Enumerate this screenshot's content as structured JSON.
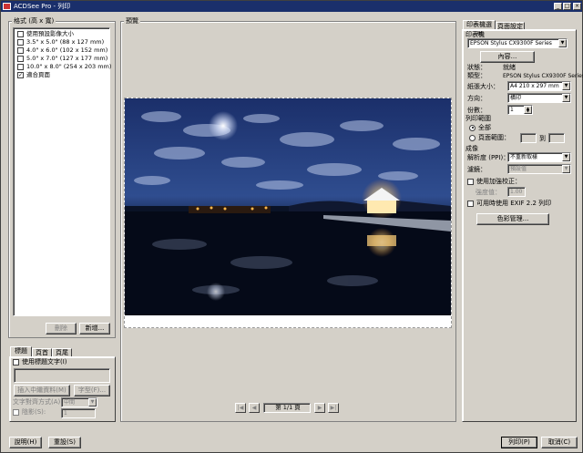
{
  "window": {
    "title": "ACDSee Pro - 列印"
  },
  "format_panel": {
    "group_label": "格式 (高 x 寬)",
    "items": [
      {
        "label": "使用預設影像大小",
        "checked": false
      },
      {
        "label": "3.5\" x 5.0\" (88 x 127 mm)",
        "checked": false
      },
      {
        "label": "4.0\" x 6.0\" (102 x 152 mm)",
        "checked": false
      },
      {
        "label": "5.0\" x 7.0\" (127 x 177 mm)",
        "checked": false
      },
      {
        "label": "10.0\" x 8.0\" (254 x 203 mm)",
        "checked": false
      },
      {
        "label": "適合頁面",
        "checked": true
      }
    ],
    "remove_button": "刪除",
    "new_button": "新增..."
  },
  "text_panel": {
    "tabs": [
      "標題",
      "頁首",
      "頁尾"
    ],
    "use_text_label": "使用標題文字(I)",
    "insert_metadata": "插入中繼資料(M)",
    "font_button": "字型(F)...",
    "alignment_label": "文字對齊方式(A):",
    "alignment_value": "中間",
    "shadow_label": "陰影(S):",
    "shadow_value": "1"
  },
  "preview": {
    "label": "預覽",
    "page_indicator": "第 1/1 頁"
  },
  "right_panel": {
    "tabs": [
      "印表機選項",
      "頁面設定"
    ],
    "printer_group": "印表機",
    "printer_name": "EPSON Stylus CX9300F Series",
    "properties_button": "內容...",
    "status_label": "狀態：",
    "status_value": "就緒",
    "type_label": "類型：",
    "type_value": "EPSON Stylus CX9300F Series",
    "paper_label": "紙張大小：",
    "paper_value": "A4 210 x 297 mm",
    "orientation_label": "方向：",
    "orientation_value": "橫印",
    "copies_label": "份數：",
    "copies_value": "1",
    "range_group": "列印範圍",
    "all_label": "全部",
    "pages_label": "頁面範圍：",
    "to_label": "到",
    "render_group": "成像",
    "resolution_label": "解析度 (PPI)：",
    "resolution_value": "不重新取樣",
    "filter_label": "濾鏡：",
    "filter_value": "預設值",
    "sharpen_label": "使用加強校正：",
    "strength_label": "強度值：",
    "strength_value": "1.00",
    "exif_label": "可用時使用 EXIF 2.2 列印",
    "color_button": "色彩管理..."
  },
  "bottom": {
    "help_button": "說明(H)",
    "reset_button": "重設(S)",
    "print_button": "列印(P)",
    "cancel_button": "取消(C)"
  }
}
